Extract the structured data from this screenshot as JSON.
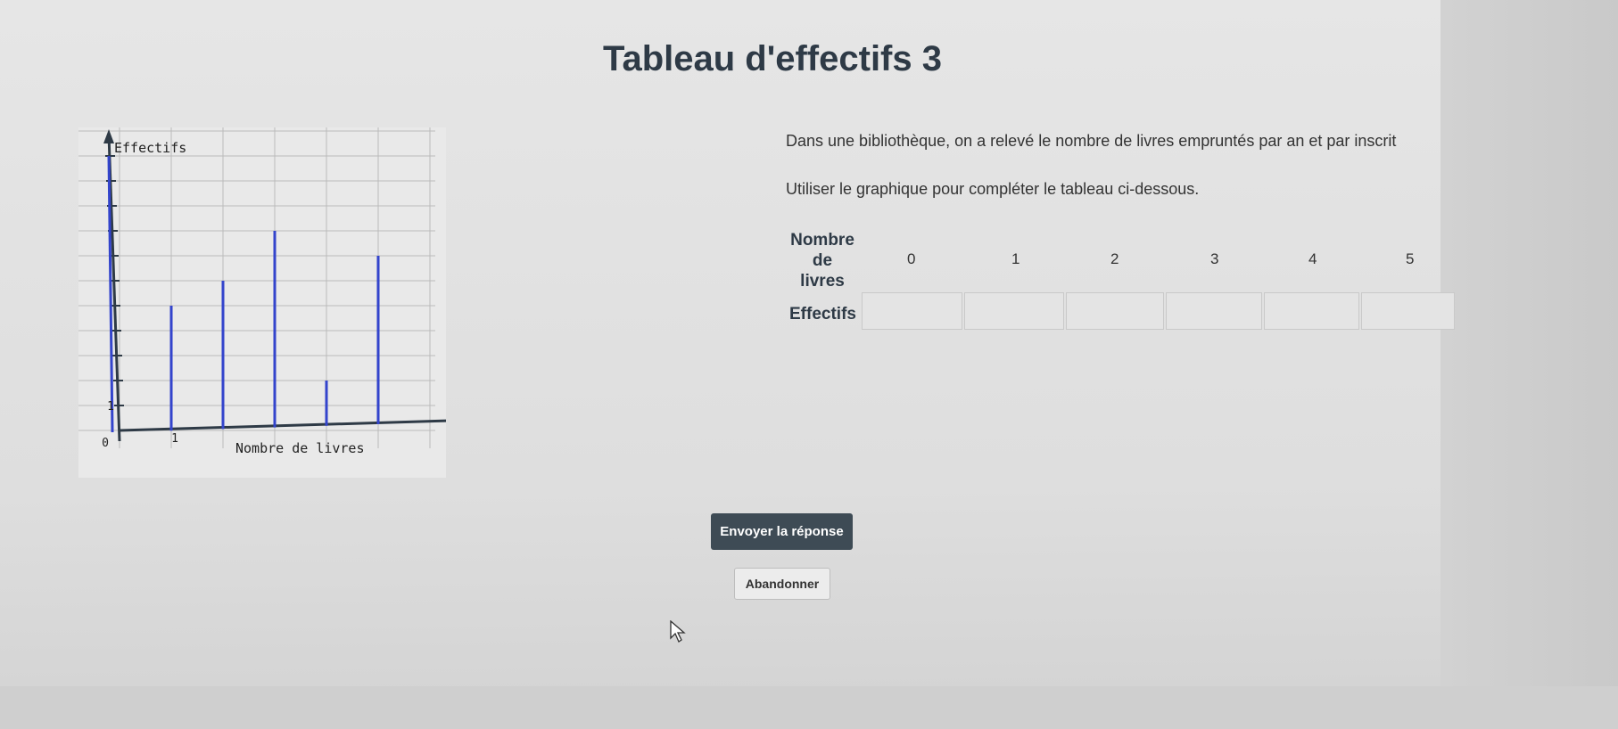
{
  "page": {
    "title": "Tableau d'effectifs 3"
  },
  "chart_data": {
    "type": "bar",
    "ylabel": "Effectifs",
    "xlabel": "Nombre de livres",
    "x_tick_labels": [
      "0",
      "1"
    ],
    "y_tick_labels": [
      "1"
    ],
    "categories": [
      0,
      1,
      2,
      3,
      4,
      5
    ],
    "values": [
      11,
      5,
      6,
      8,
      2,
      7
    ],
    "grid": true,
    "color": "#3344cc"
  },
  "problem": {
    "statement": "Dans une bibliothèque, on a relevé le nombre de livres empruntés par an et par inscrit",
    "instruction": "Utiliser le graphique pour compléter le tableau ci-dessous."
  },
  "table": {
    "header_label_line1": "Nombre",
    "header_label_line2": "de",
    "header_label_line3": "livres",
    "values": [
      "0",
      "1",
      "2",
      "3",
      "4",
      "5"
    ],
    "row_label": "Effectifs",
    "inputs": [
      "",
      "",
      "",
      "",
      "",
      ""
    ]
  },
  "buttons": {
    "submit": "Envoyer la réponse",
    "abandon": "Abandonner"
  }
}
